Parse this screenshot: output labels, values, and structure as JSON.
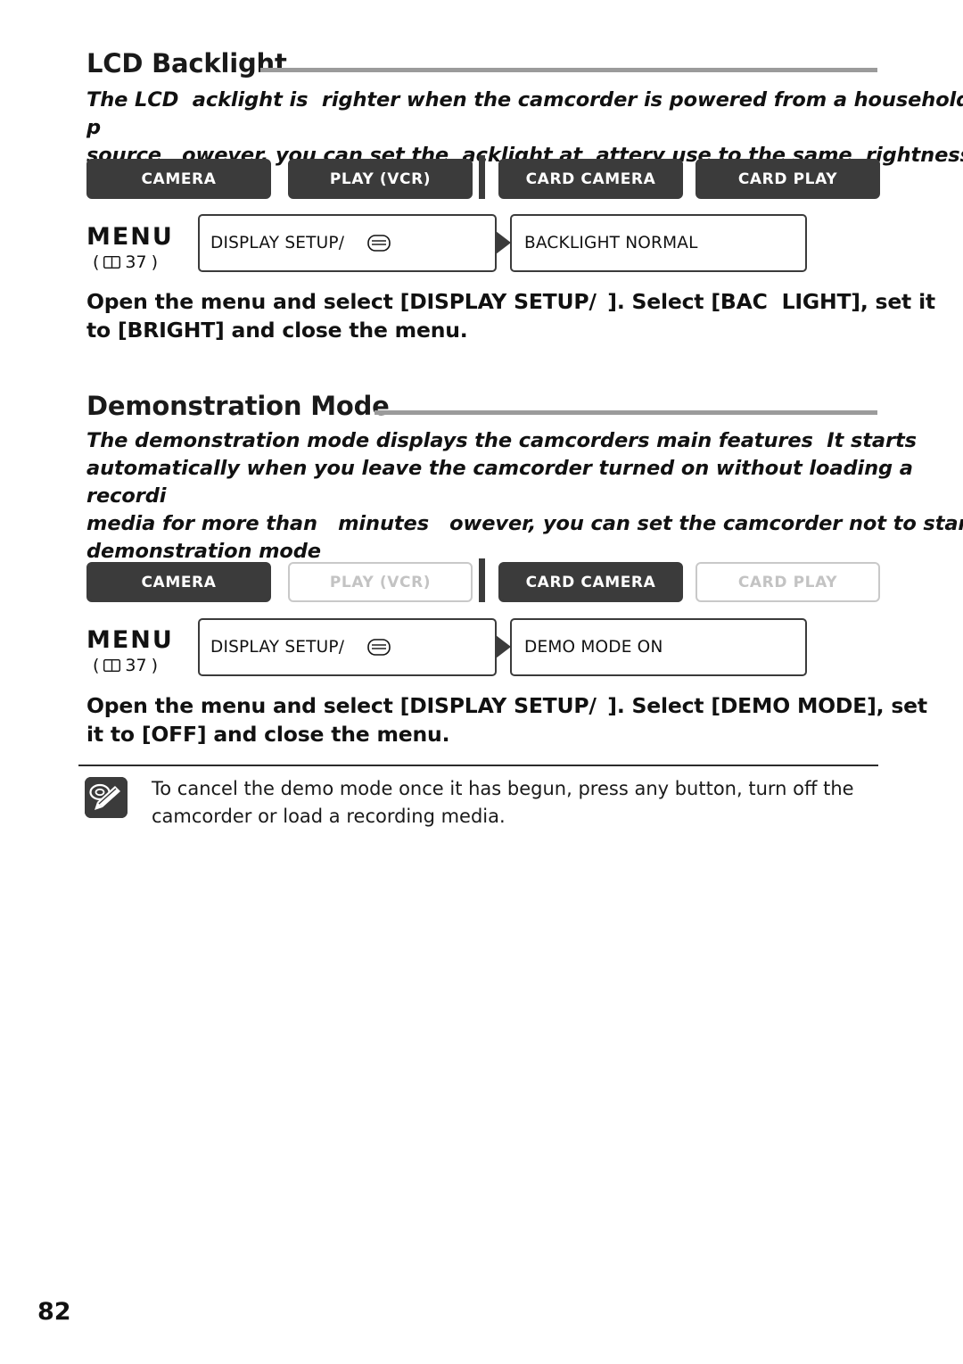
{
  "page_number": "82",
  "sections": [
    {
      "heading": "LCD Backlight",
      "intro": "The LCD  acklight is  righter when the camcorder is powered from a household p\nsource   owever, you can set the  acklight at  attery use to the same  rightness",
      "modes": [
        {
          "label": "CAMERA",
          "state": "on"
        },
        {
          "label": "PLAY (VCR)",
          "state": "on"
        },
        {
          "label": "CARD CAMERA",
          "state": "on"
        },
        {
          "label": "CARD PLAY",
          "state": "on"
        }
      ],
      "menu_label": "MENU",
      "menu_ref": "37",
      "menu_box_1": "DISPLAY SETUP/",
      "menu_box_1_icon": "tv-icon",
      "menu_box_2": "BACKLIGHT   NORMAL",
      "instruction": "Open the menu and select [DISPLAY SETUP/  ]. Select [BAC  LIGHT], set it\nto [BRIGHT] and close the menu."
    },
    {
      "heading": "Demonstration Mode",
      "intro": "The demonstration mode displays the camcorders main features  It starts\nautomatically when you leave the camcorder turned on without loading a recordi\nmedia for more than   minutes   owever, you can set the camcorder not to start\ndemonstration mode",
      "modes": [
        {
          "label": "CAMERA",
          "state": "on"
        },
        {
          "label": "PLAY (VCR)",
          "state": "off"
        },
        {
          "label": "CARD CAMERA",
          "state": "on"
        },
        {
          "label": "CARD PLAY",
          "state": "off"
        }
      ],
      "menu_label": "MENU",
      "menu_ref": "37",
      "menu_box_1": "DISPLAY SETUP/",
      "menu_box_1_icon": "tv-icon",
      "menu_box_2": "DEMO MODE   ON",
      "instruction": "Open the menu and select [DISPLAY SETUP/  ]. Select [DEMO MODE], set\nit to [OFF] and close the menu."
    }
  ],
  "note": {
    "icon": "note-pencil-icon",
    "text": "To cancel the demo mode once it has begun, press any button, turn off the\ncamcorder or load a recording media."
  }
}
